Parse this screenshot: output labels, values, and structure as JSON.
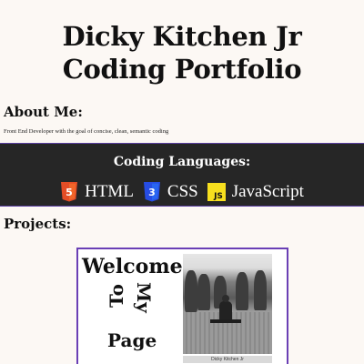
{
  "header": {
    "title_line1": "Dicky Kitchen Jr",
    "title_line2": "Coding Portfolio"
  },
  "about": {
    "heading": "About Me:",
    "text": "Front End Developer with the goal of concise, clean, semantic coding"
  },
  "languages": {
    "heading": "Coding Languages:",
    "items": [
      {
        "label": "HTML",
        "icon": "html5-icon",
        "icon_text": "5",
        "color": "#e44d26"
      },
      {
        "label": "CSS",
        "icon": "css3-icon",
        "icon_text": "3",
        "color": "#264de4"
      },
      {
        "label": "JavaScript",
        "icon": "javascript-icon",
        "icon_text": "JS",
        "color": "#f7df1e"
      }
    ]
  },
  "projects": {
    "heading": "Projects:",
    "card": {
      "welcome": "Welcome",
      "to": "To",
      "my": "My",
      "page": "Page",
      "photo_caption": "Dicky Kitchen Jr",
      "border_color": "#6a3fb5"
    }
  },
  "colors": {
    "background": "#fcf8f4",
    "band_background": "#262626",
    "accent": "#5a3fa0"
  }
}
